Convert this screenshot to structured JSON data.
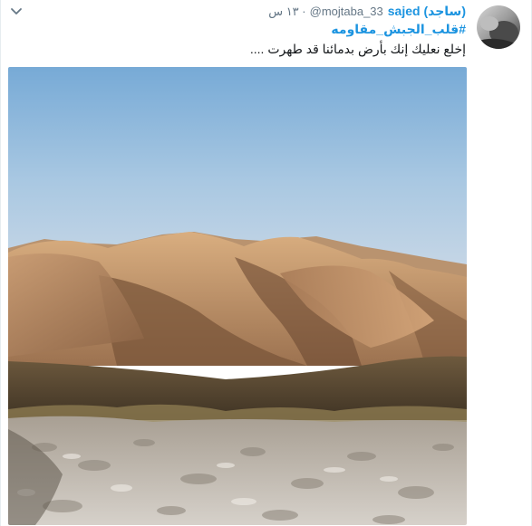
{
  "tweet": {
    "display_name": "sajed (ساجد)",
    "handle": "@mojtaba_33",
    "separator": "·",
    "time": "١٣ س",
    "hashtag": "#قلب_الجبش_مقاومه",
    "text": "إخلع نعليك إنك بأرض بدمائنا قد طهرت ....",
    "menu_icon": "chevron-down-icon",
    "media_kind": "photo of mountains"
  },
  "colors": {
    "link": "#1c94e0",
    "muted": "#657786",
    "text": "#14171a",
    "sky": "#7fb0d8"
  }
}
